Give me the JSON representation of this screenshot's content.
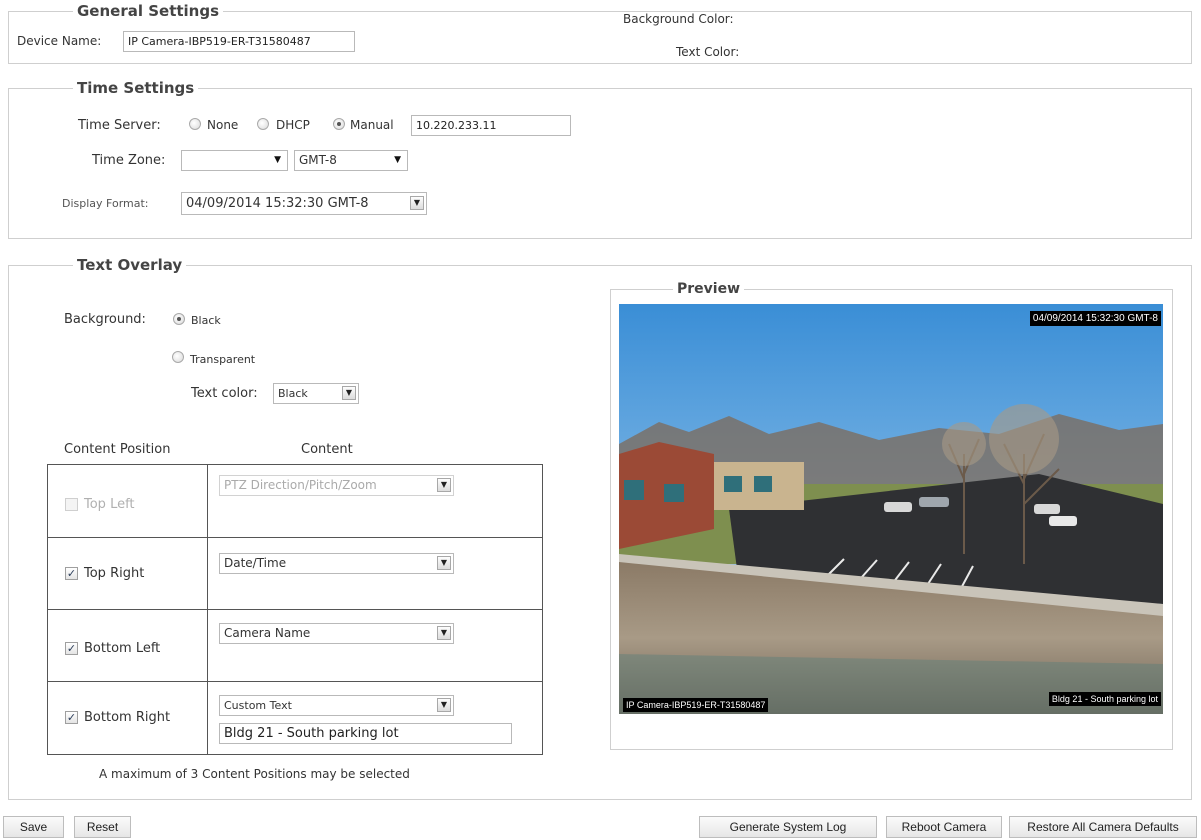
{
  "general": {
    "legend": "General Settings",
    "device_name_label": "Device Name:",
    "device_name_value": "IP Camera-IBP519-ER-T31580487",
    "bg_color_label": "Background Color:",
    "text_color_label": "Text Color:"
  },
  "time": {
    "legend": "Time Settings",
    "server_label": "Time Server:",
    "opt_none": "None",
    "opt_dhcp": "DHCP",
    "opt_manual": "Manual",
    "server_selected": "Manual",
    "server_value": "10.220.233.11",
    "zone_label": "Time Zone:",
    "zone_select": "",
    "zone_offset": "GMT-8",
    "format_label": "Display Format:",
    "format_value": "04/09/2014 15:32:30 GMT-8"
  },
  "overlay": {
    "legend": "Text Overlay",
    "background_label": "Background:",
    "opt_black": "Black",
    "opt_transparent": "Transparent",
    "background_selected": "Black",
    "text_color_label": "Text color:",
    "text_color_value": "Black",
    "col_position": "Content Position",
    "col_content": "Content",
    "rows": [
      {
        "position": "Top Left",
        "checked": false,
        "disabled": true,
        "content": "PTZ Direction/Pitch/Zoom"
      },
      {
        "position": "Top Right",
        "checked": true,
        "disabled": false,
        "content": "Date/Time"
      },
      {
        "position": "Bottom Left",
        "checked": true,
        "disabled": false,
        "content": "Camera Name"
      },
      {
        "position": "Bottom Right",
        "checked": true,
        "disabled": false,
        "content": "Custom Text",
        "custom_text": "Bldg 21 - South parking lot"
      }
    ],
    "note": "A maximum of 3 Content Positions may be selected"
  },
  "preview": {
    "legend": "Preview",
    "top_right": "04/09/2014 15:32:30 GMT-8",
    "bottom_left": "IP Camera-IBP519-ER-T31580487",
    "bottom_right": "Bldg 21 - South parking lot"
  },
  "buttons": {
    "save": "Save",
    "reset": "Reset",
    "generate_log": "Generate System Log",
    "reboot": "Reboot Camera",
    "restore": "Restore All Camera Defaults"
  }
}
